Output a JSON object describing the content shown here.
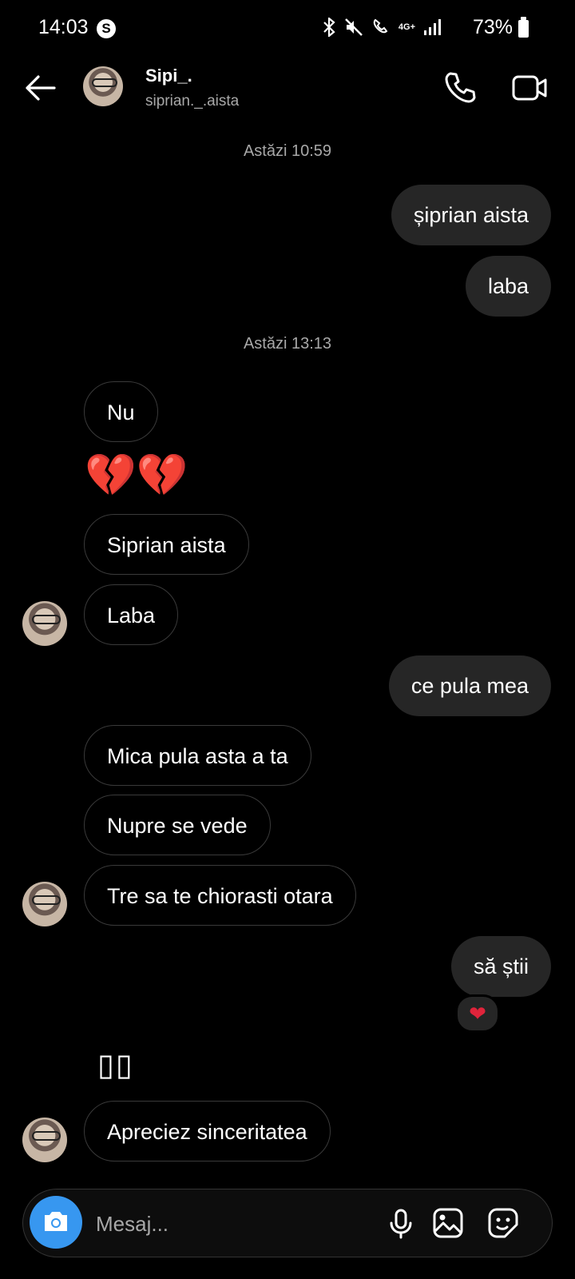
{
  "status_bar": {
    "time": "14:03",
    "notification_badge": "S",
    "network": "4G+",
    "battery": "73%"
  },
  "header": {
    "name": "Sipi_.",
    "username": "siprian._.aista"
  },
  "timestamps": [
    "Astăzi 10:59",
    "Astăzi 13:13"
  ],
  "messages": [
    {
      "dir": "out",
      "text": "șiprian aista"
    },
    {
      "dir": "out",
      "text": "laba"
    },
    {
      "dir": "in",
      "text": "Nu"
    },
    {
      "dir": "in",
      "text": "💔💔",
      "type": "emoji"
    },
    {
      "dir": "in",
      "text": "Siprian aista"
    },
    {
      "dir": "in",
      "text": "Laba"
    },
    {
      "dir": "out",
      "text": "ce pula mea"
    },
    {
      "dir": "in",
      "text": "Mica pula asta a ta"
    },
    {
      "dir": "in",
      "text": "Nupre se vede"
    },
    {
      "dir": "in",
      "text": "Tre sa te chiorasti otara"
    },
    {
      "dir": "out",
      "text": "să știi",
      "reaction": "❤"
    },
    {
      "dir": "in",
      "text": "▯▯",
      "type": "unrendered-emoji"
    },
    {
      "dir": "in",
      "text": "Apreciez sinceritatea"
    }
  ],
  "composer": {
    "placeholder": "Mesaj..."
  },
  "icons": {
    "back": "arrow-left-icon",
    "call": "phone-icon",
    "video": "video-camera-icon",
    "camera": "camera-icon",
    "mic": "microphone-icon",
    "gallery": "image-icon",
    "sticker": "sticker-icon"
  },
  "colors": {
    "background": "#000000",
    "outgoing_bubble": "#262626",
    "camera_button": "#3797f0",
    "timestamp_text": "#a8a8a8",
    "emoji_heart": "#e8308c",
    "reaction_heart": "#e0243b"
  }
}
